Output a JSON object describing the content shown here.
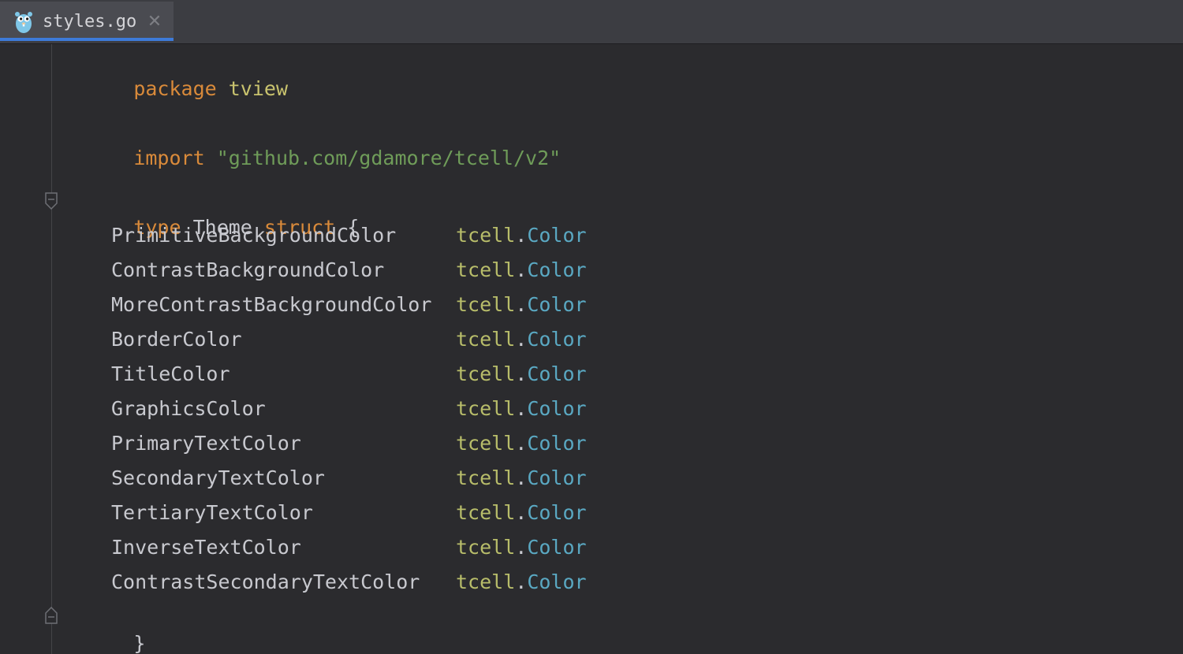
{
  "tab": {
    "title": "styles.go",
    "close_glyph": "✕",
    "icon": "gopher-icon"
  },
  "code": {
    "package_kw": "package",
    "package_name": "tview",
    "import_kw": "import",
    "import_path": "\"github.com/gdamore/tcell/v2\"",
    "type_kw": "type",
    "type_name": "Theme",
    "struct_kw": "struct",
    "open_brace": "{",
    "close_brace": "}",
    "fields": [
      {
        "name": "PrimitiveBackgroundColor",
        "pkg": "tcell",
        "type": "Color"
      },
      {
        "name": "ContrastBackgroundColor",
        "pkg": "tcell",
        "type": "Color"
      },
      {
        "name": "MoreContrastBackgroundColor",
        "pkg": "tcell",
        "type": "Color"
      },
      {
        "name": "BorderColor",
        "pkg": "tcell",
        "type": "Color"
      },
      {
        "name": "TitleColor",
        "pkg": "tcell",
        "type": "Color"
      },
      {
        "name": "GraphicsColor",
        "pkg": "tcell",
        "type": "Color"
      },
      {
        "name": "PrimaryTextColor",
        "pkg": "tcell",
        "type": "Color"
      },
      {
        "name": "SecondaryTextColor",
        "pkg": "tcell",
        "type": "Color"
      },
      {
        "name": "TertiaryTextColor",
        "pkg": "tcell",
        "type": "Color"
      },
      {
        "name": "InverseTextColor",
        "pkg": "tcell",
        "type": "Color"
      },
      {
        "name": "ContrastSecondaryTextColor",
        "pkg": "tcell",
        "type": "Color"
      }
    ]
  },
  "colors": {
    "background": "#2b2b2e",
    "keyword": "#d98a3a",
    "string": "#6f9c59",
    "type": "#5aa8c2",
    "package_ref": "#b8bd6a",
    "tab_underline": "#3d7bd9"
  }
}
